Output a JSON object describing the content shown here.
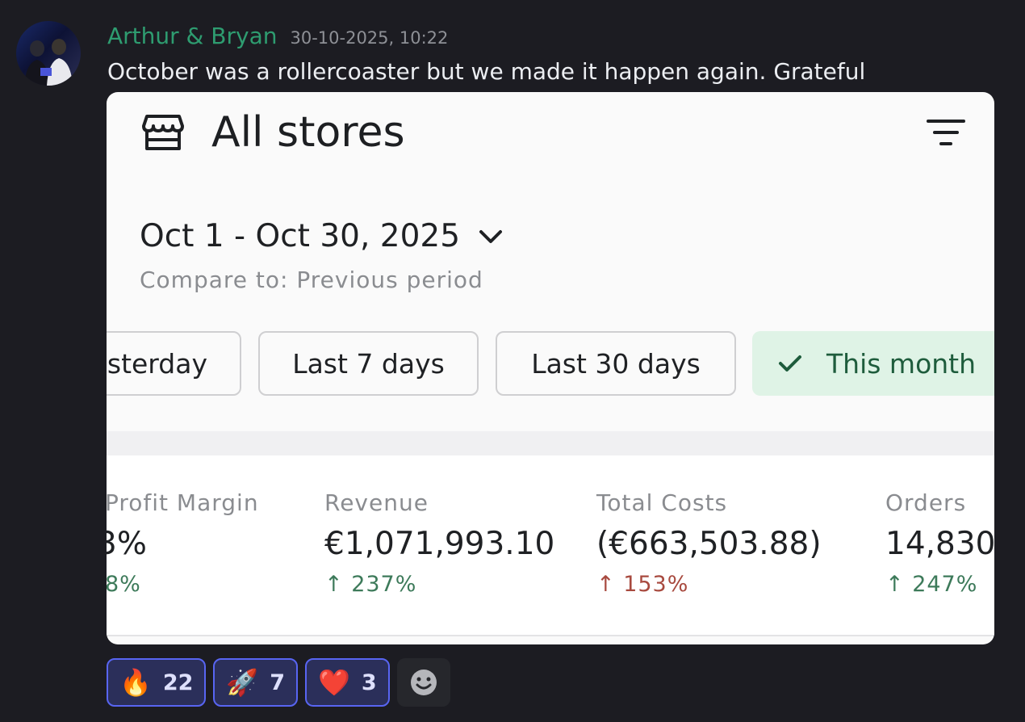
{
  "message": {
    "author": "Arthur & Bryan",
    "timestamp": "30-10-2025, 10:22",
    "text": "October was a rollercoaster but we made it happen again. Grateful"
  },
  "card": {
    "title": "All stores",
    "date_range": "Oct 1 - Oct 30, 2025",
    "compare_text": "Compare to: Previous period",
    "period_buttons": [
      {
        "label": "sterday",
        "selected": false
      },
      {
        "label": "Last 7 days",
        "selected": false
      },
      {
        "label": "Last 30 days",
        "selected": false
      },
      {
        "label": "This month",
        "selected": true
      }
    ],
    "metrics": [
      {
        "label": "Profit Margin",
        "value": "3%",
        "change": "8%",
        "trend": "neutral"
      },
      {
        "label": "Revenue",
        "value": "€1,071,993.10",
        "change": "↑ 237%",
        "trend": "up-good"
      },
      {
        "label": "Total Costs",
        "value": "(€663,503.88)",
        "change": "↑ 153%",
        "trend": "up-bad"
      },
      {
        "label": "Orders",
        "value": "14,830",
        "change": "↑ 247%",
        "trend": "up-good"
      }
    ],
    "colors": {
      "selected_bg": "#dff3e6",
      "positive": "#3d7a5a",
      "negative": "#a84a3f"
    }
  },
  "reactions": [
    {
      "emoji": "🔥",
      "icon": "fire-icon",
      "count": "22"
    },
    {
      "emoji": "🚀",
      "icon": "rocket-icon",
      "count": "7"
    },
    {
      "emoji": "❤️",
      "icon": "heart-icon",
      "count": "3"
    }
  ],
  "colors": {
    "author": "#2e9c70",
    "background": "#1c1c22",
    "reaction_border": "#5865f2"
  }
}
